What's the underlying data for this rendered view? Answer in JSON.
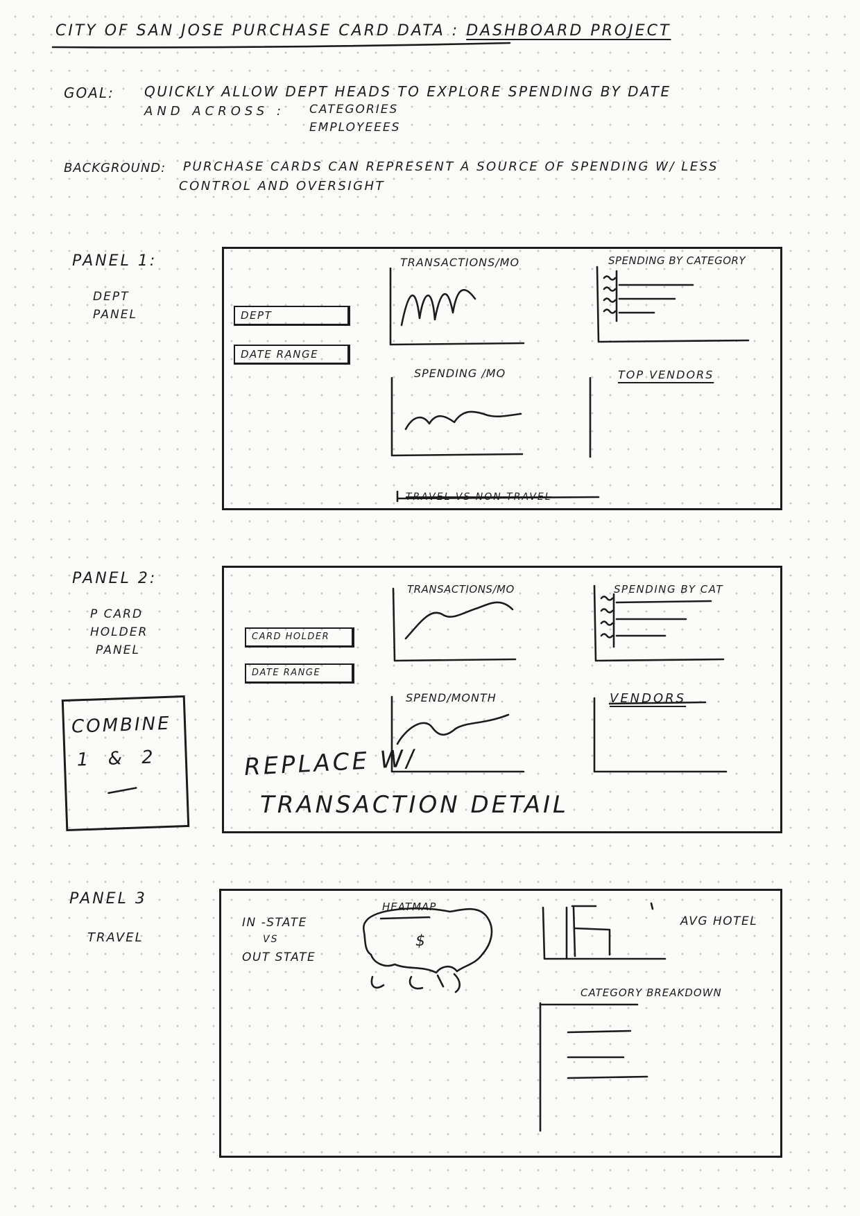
{
  "header": {
    "title": "CITY OF SAN JOSE PURCHASE CARD DATA :",
    "title_part2": "DASHBOARD PROJECT"
  },
  "goal": {
    "label": "GOAL:",
    "line1": "QUICKLY ALLOW DEPT HEADS TO EXPLORE SPENDING BY DATE",
    "line2": "AND ACROSS :",
    "item1": "CATEGORIES",
    "item2": "EMPLOYEEES"
  },
  "background": {
    "label": "BACKGROUND:",
    "line1": "PURCHASE CARDS CAN REPRESENT A SOURCE OF SPENDING W/ LESS",
    "line2": "CONTROL AND OVERSIGHT"
  },
  "panel1": {
    "label": "PANEL 1:",
    "sub1": "DEPT",
    "sub2": "PANEL",
    "dept_field": "DEPT",
    "date_field": "DATE RANGE",
    "chart_transactions": "TRANSACTIONS/MO",
    "chart_spending_cat": "SPENDING BY CATEGORY",
    "chart_spending_mo": "SPENDING /MO",
    "top_vendors": "TOP VENDORS",
    "travel_strike": "TRAVEL VS NON TRAVEL"
  },
  "panel2": {
    "label": "PANEL 2:",
    "sub1": "P CARD",
    "sub2": "HOLDER",
    "sub3": "PANEL",
    "cardholder_field": "CARD HOLDER",
    "date_field": "DATE RANGE",
    "chart_transactions": "TRANSACTIONS/MO",
    "chart_spending_cat": "SPENDING BY CAT",
    "chart_spend_month": "SPEND/MONTH",
    "vendors": "VENDORS",
    "note_replace1": "REPLACE W/",
    "note_replace2": "TRANSACTION DETAIL"
  },
  "combine_note": {
    "line1": "COMBINE",
    "line2": "1 & 2"
  },
  "panel3": {
    "label": "PANEL 3",
    "sub": "TRAVEL",
    "instate1": "IN -STATE",
    "instate2": "VS",
    "instate3": "OUT STATE",
    "heatmap": "HEATMAP",
    "heatmap_symbol": "$",
    "avg_hotel": "AVG HOTEL",
    "category_breakdown": "CATEGORY BREAKDOWN"
  }
}
